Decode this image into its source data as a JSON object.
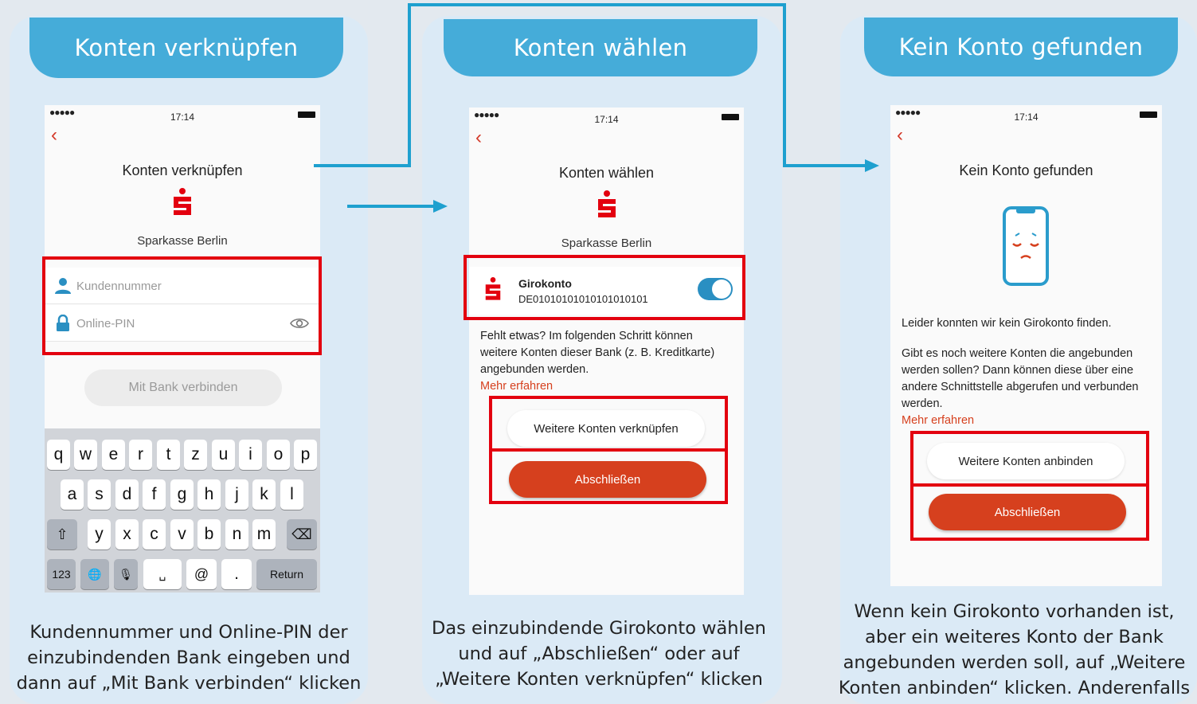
{
  "accent_color": "#45acd9",
  "highlight_color": "#e3000f",
  "brand_red": "#d6401e",
  "steps": [
    {
      "header": "Konten verknüpfen",
      "status": {
        "time": "17:14"
      },
      "title": "Konten verknüpfen",
      "bank_name": "Sparkasse Berlin",
      "customer_placeholder": "Kundennummer",
      "pin_placeholder": "Online-PIN",
      "connect_button": "Mit Bank verbinden",
      "keyboard": {
        "row1": [
          "q",
          "w",
          "e",
          "r",
          "t",
          "z",
          "u",
          "i",
          "o",
          "p"
        ],
        "row2": [
          "a",
          "s",
          "d",
          "f",
          "g",
          "h",
          "j",
          "k",
          "l"
        ],
        "row3": [
          "y",
          "x",
          "c",
          "v",
          "b",
          "n",
          "m"
        ],
        "shift": "⇧",
        "delete": "⌫",
        "numbers": "123",
        "globe": "🌐",
        "mic": "🎙",
        "space": "␣",
        "at": "@",
        "dot": ".",
        "return": "Return"
      },
      "caption": "Kundennummer und Online-PIN der einzubindenden Bank eingeben und dann auf „Mit Bank verbinden“ klicken"
    },
    {
      "header": "Konten wählen",
      "status": {
        "time": "17:14"
      },
      "title": "Konten wählen",
      "bank_name": "Sparkasse Berlin",
      "account_name": "Girokonto",
      "account_iban": "DE01010101010101010101",
      "account_selected": true,
      "info_text": "Fehlt etwas? Im folgenden Schritt können weitere Konten dieser Bank (z. B. Kreditkarte) angebunden werden.",
      "more_link": "Mehr erfahren",
      "secondary_button": "Weitere Konten verknüpfen",
      "primary_button": "Abschließen",
      "caption": "Das einzubindende Girokonto wählen und auf „Abschließen“ oder auf „Weitere Konten verknüpfen“ klicken"
    },
    {
      "header": "Kein Konto gefunden",
      "status": {
        "time": "17:14"
      },
      "title": "Kein Konto gefunden",
      "message": "Leider konnten wir kein Girokonto finden.",
      "info_text": "Gibt es noch weitere Konten die angebunden werden sollen? Dann können diese über eine andere Schnittstelle abgerufen und verbunden werden.",
      "more_link": "Mehr erfahren",
      "secondary_button": "Weitere Konten anbinden",
      "primary_button": "Abschließen",
      "caption": "Wenn kein Girokonto vorhanden ist, aber ein weiteres Konto der Bank angebunden werden soll, auf „Weitere Konten anbinden“ klicken. Anderenfalls auf „Abschließen“ klicken"
    }
  ]
}
